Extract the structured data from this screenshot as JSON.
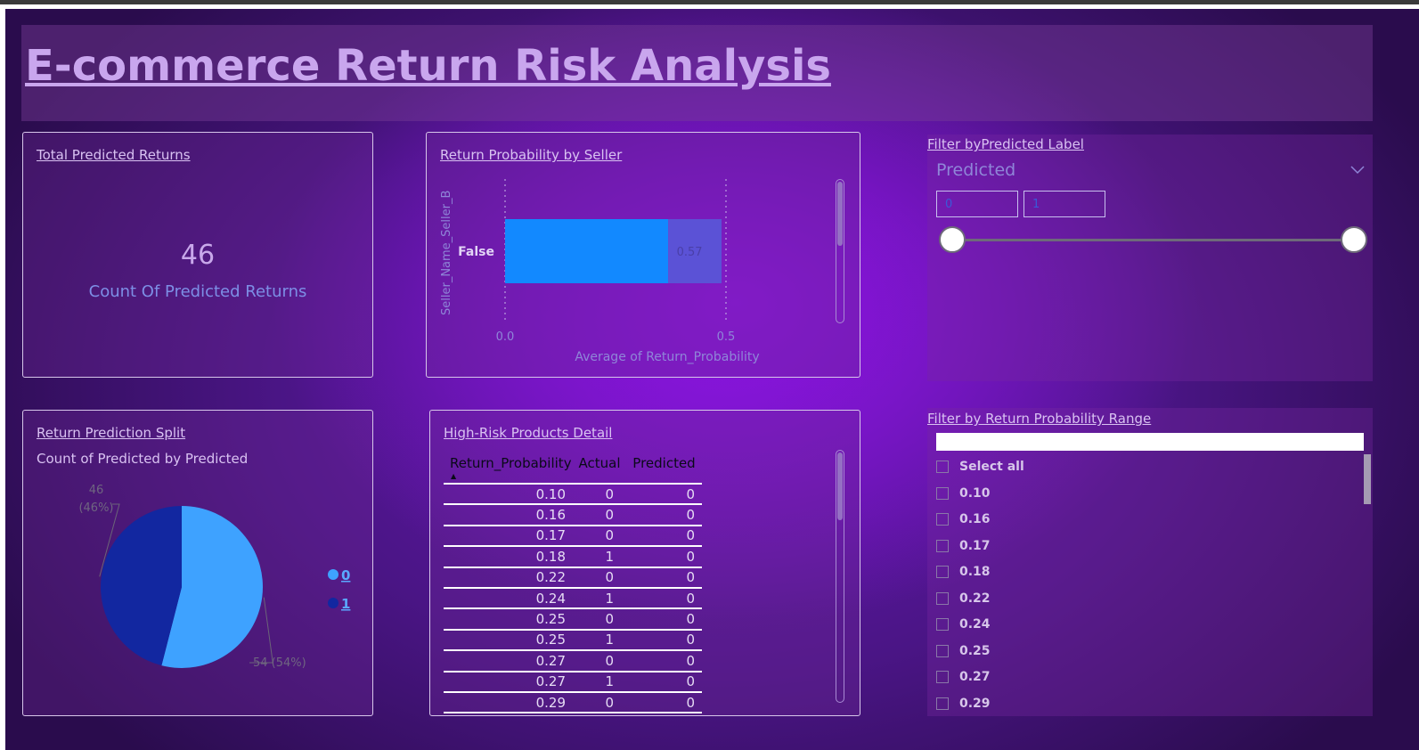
{
  "title": "E-commerce Return Risk Analysis",
  "kpi": {
    "title": "Total Predicted Returns",
    "value": "46",
    "label": "Count Of Predicted Returns"
  },
  "bar_card": {
    "title": "Return Probability by Seller"
  },
  "pie_card": {
    "title": "Return Prediction Split",
    "subtitle": "Count of Predicted by Predicted"
  },
  "table_card": {
    "title": "High-Risk Products Detail"
  },
  "slicer_predicted": {
    "title": "Filter byPredicted Label",
    "field": "Predicted",
    "min_value": "0",
    "max_value": "1"
  },
  "slicer_probability": {
    "title": "Filter by Return Probability Range",
    "search_value": "",
    "select_all": "Select all",
    "items": [
      "0.10",
      "0.16",
      "0.17",
      "0.18",
      "0.22",
      "0.24",
      "0.25",
      "0.27",
      "0.29"
    ]
  },
  "icons": {
    "dropdown": "chevron-down-icon",
    "sort": "sort-ascending-icon"
  },
  "colors": {
    "bar": "#1289ff",
    "bar_highlight": "#5b52d6",
    "pie_0": "#3ea2ff",
    "pie_1": "#1227a0",
    "title": "#c9a6ee"
  },
  "chart_data": [
    {
      "type": "bar",
      "orientation": "horizontal",
      "title": "Return Probability by Seller",
      "xlabel": "Average of Return_Probability",
      "ylabel": "Seller_Name_Seller_B",
      "categories": [
        "False"
      ],
      "values": [
        0.49
      ],
      "data_labels": [
        "0.57"
      ],
      "xlim": [
        0.0,
        0.5
      ],
      "xticks": [
        "0.0",
        "0.5"
      ],
      "grid": true
    },
    {
      "type": "pie",
      "title": "Return Prediction Split",
      "subtitle": "Count of Predicted by Predicted",
      "categories": [
        "0",
        "1"
      ],
      "values": [
        54,
        46
      ],
      "data_labels": [
        "54 (54%)",
        "46\n(46%)"
      ],
      "legend": "right"
    },
    {
      "type": "table",
      "title": "High-Risk Products Detail",
      "columns": [
        "Return_Probability",
        "Actual",
        "Predicted"
      ],
      "sort": "Return_Probability ascending",
      "rows": [
        [
          "0.10",
          "0",
          "0"
        ],
        [
          "0.16",
          "0",
          "0"
        ],
        [
          "0.17",
          "0",
          "0"
        ],
        [
          "0.18",
          "1",
          "0"
        ],
        [
          "0.22",
          "0",
          "0"
        ],
        [
          "0.24",
          "1",
          "0"
        ],
        [
          "0.25",
          "0",
          "0"
        ],
        [
          "0.25",
          "1",
          "0"
        ],
        [
          "0.27",
          "0",
          "0"
        ],
        [
          "0.27",
          "1",
          "0"
        ],
        [
          "0.29",
          "0",
          "0"
        ]
      ]
    }
  ]
}
